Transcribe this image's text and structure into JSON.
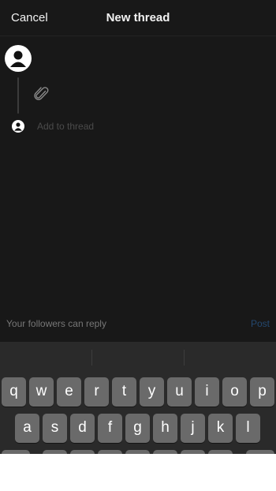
{
  "header": {
    "cancel_label": "Cancel",
    "title": "New thread"
  },
  "composer": {
    "avatar_icon": "user-avatar-icon",
    "attach_icon": "paperclip-icon",
    "add_to_thread_placeholder": "Add to thread"
  },
  "footer": {
    "reply_setting": "Your followers can reply",
    "post_label": "Post"
  },
  "keyboard": {
    "row1": [
      "q",
      "w",
      "e",
      "r",
      "t",
      "y",
      "u",
      "i",
      "o",
      "p"
    ],
    "row2": [
      "a",
      "s",
      "d",
      "f",
      "g",
      "h",
      "j",
      "k",
      "l"
    ]
  },
  "colors": {
    "background": "#181818",
    "text": "#f3f3f3",
    "muted": "#777777",
    "post_disabled": "#24486f",
    "key": "#6a6a6a",
    "keyboard_bg": "#2a2a2a"
  }
}
